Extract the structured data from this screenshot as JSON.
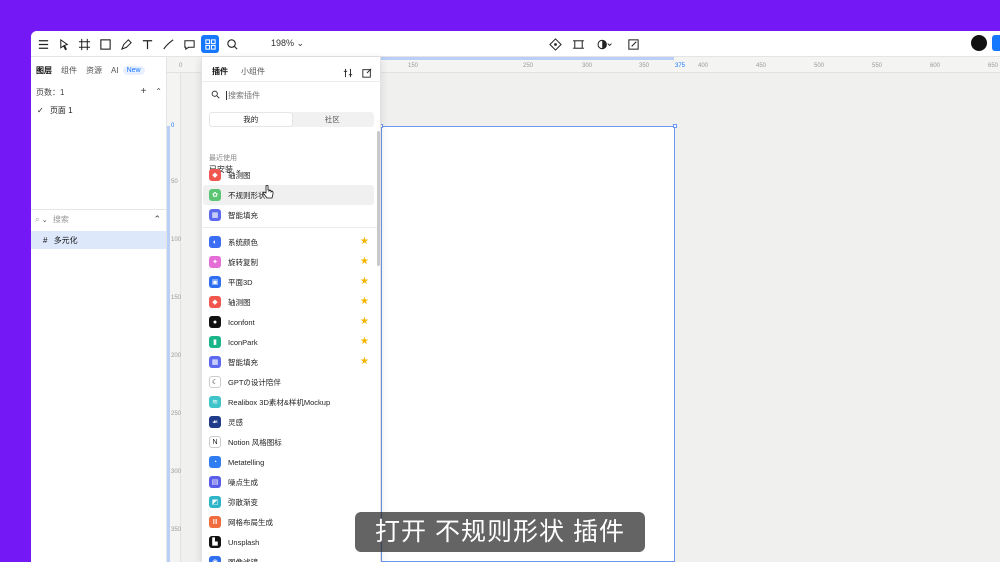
{
  "toolbar": {
    "zoom_label": "198%",
    "zoom_caret": "⌄"
  },
  "left_panel": {
    "tabs": [
      {
        "label": "图层"
      },
      {
        "label": "组件"
      },
      {
        "label": "资源"
      },
      {
        "label": "AI"
      }
    ],
    "new_badge": "New",
    "pages_label": "页数：1",
    "page_item": "页面 1",
    "search_placeholder": "搜索",
    "layer_item": "多元化"
  },
  "rulers": {
    "top_ticks": [
      "0",
      "150",
      "250",
      "300",
      "350",
      "375",
      "400",
      "450",
      "500",
      "550",
      "600",
      "650"
    ],
    "left_ticks": [
      "0",
      "50",
      "100",
      "150",
      "200",
      "250",
      "300",
      "350"
    ]
  },
  "plugin_panel": {
    "tabs": [
      {
        "label": "插件"
      },
      {
        "label": "小组件"
      }
    ],
    "search_placeholder": "搜索插件",
    "segments": [
      {
        "label": "我的"
      },
      {
        "label": "社区"
      }
    ],
    "installed_label": "已安装",
    "recent_label": "最近使用",
    "recent": [
      {
        "label": "轴测图",
        "color": "#f0574f"
      },
      {
        "label": "不规则形状",
        "color": "#5cc573"
      },
      {
        "label": "智能填充",
        "color": "#5d6af0"
      }
    ],
    "plugins": [
      {
        "label": "系统颜色",
        "color": "#3b6ef5",
        "starred": true
      },
      {
        "label": "旋转复制",
        "color": "#e46ed6",
        "starred": true
      },
      {
        "label": "平面3D",
        "color": "#2e6ff2",
        "starred": true
      },
      {
        "label": "轴测图",
        "color": "#f0574f",
        "starred": true
      },
      {
        "label": "Iconfont",
        "color": "#111111",
        "starred": true
      },
      {
        "label": "IconPark",
        "color": "#1bb58a",
        "starred": true
      },
      {
        "label": "智能填充",
        "color": "#5d6af0",
        "starred": true
      },
      {
        "label": "GPTの设计陪伴",
        "color": "#ffffff",
        "starred": false
      },
      {
        "label": "Realibox 3D素材&样机Mockup",
        "color": "#3ec4c9",
        "starred": false
      },
      {
        "label": "灵感",
        "color": "#1f3b8a",
        "starred": false
      },
      {
        "label": "Notion 风格图标",
        "color": "#ffffff",
        "starred": false
      },
      {
        "label": "Metatelling",
        "color": "#2f7df0",
        "starred": false
      },
      {
        "label": "噪点生成",
        "color": "#5a5de8",
        "starred": false
      },
      {
        "label": "弥散渐变",
        "color": "#2fb5c8",
        "starred": false
      },
      {
        "label": "网格布局生成",
        "color": "#f06b3d",
        "starred": false
      },
      {
        "label": "Unsplash",
        "color": "#111111",
        "starred": false
      },
      {
        "label": "图像滤镜",
        "color": "#2e6ff2",
        "starred": false
      }
    ],
    "star_glyph": "★"
  },
  "subtitle": "打开 不规则形状 插件"
}
